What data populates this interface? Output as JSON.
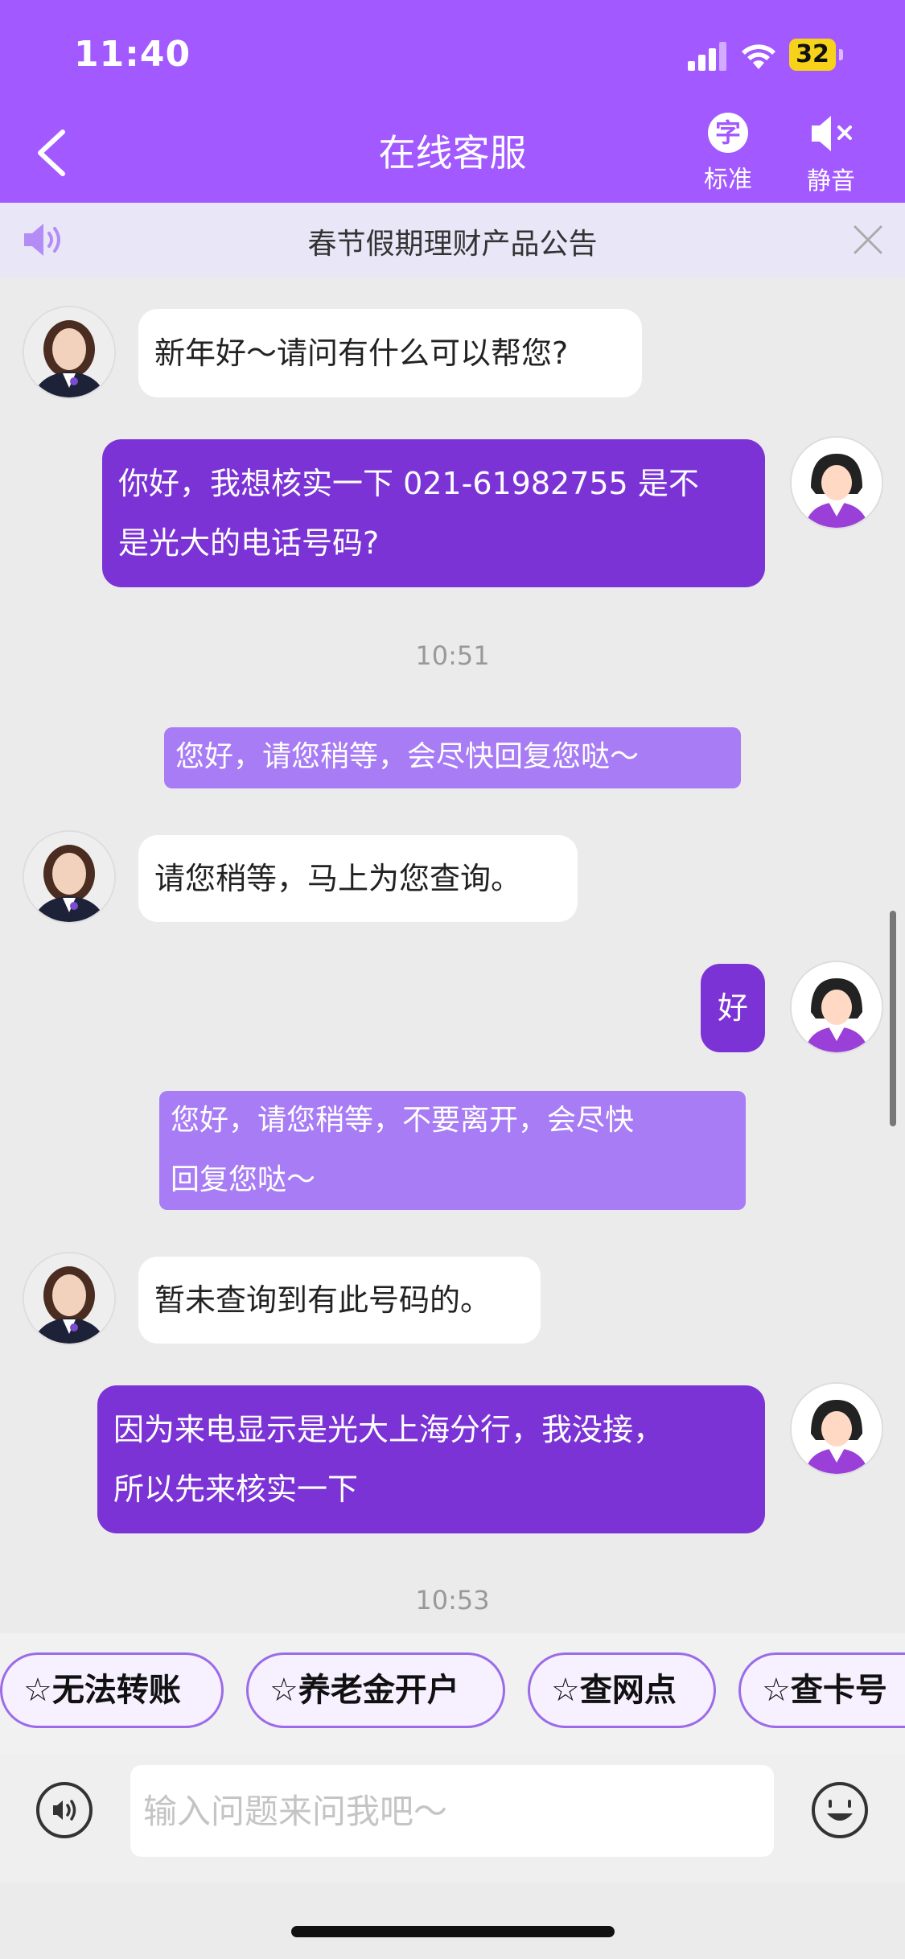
{
  "status_bar": {
    "time": "11:40",
    "battery": "32"
  },
  "nav": {
    "title": "在线客服",
    "standard_icon": "字",
    "standard_label": "标准",
    "mute_label": "静音"
  },
  "notice": {
    "text": "春节假期理财产品公告"
  },
  "messages": [
    {
      "type": "agent",
      "text": "新年好～请问有什么可以帮您?"
    },
    {
      "type": "user",
      "lines": [
        "你好，我想核实一下 021-61982755 是不",
        "是光大的电话号码?"
      ]
    },
    {
      "type": "time",
      "text": "10:51"
    },
    {
      "type": "system",
      "text": "您好，请您稍等，会尽快回复您哒～"
    },
    {
      "type": "agent",
      "text": "请您稍等，马上为您查询。"
    },
    {
      "type": "user",
      "text": "好"
    },
    {
      "type": "system",
      "lines": [
        "您好，请您稍等，不要离开，会尽快",
        "回复您哒～"
      ]
    },
    {
      "type": "agent",
      "text": "暂未查询到有此号码的。"
    },
    {
      "type": "user",
      "lines": [
        "因为来电显示是光大上海分行，我没接，",
        "所以先来核实一下"
      ]
    },
    {
      "type": "time",
      "text": "10:53"
    }
  ],
  "quick_replies": [
    "☆无法转账",
    "☆养老金开户",
    "☆查网点",
    "☆查卡号"
  ],
  "input": {
    "placeholder": "输入问题来问我吧～"
  },
  "colors": {
    "header": "#a259ff",
    "user_bubble": "#7b33d6",
    "system_bubble": "#a77cf5",
    "notice_bg": "#e9e6f8"
  },
  "icons": [
    "back-arrow-icon",
    "font-size-icon",
    "mute-speaker-icon",
    "speaker-icon",
    "close-icon",
    "voice-icon",
    "emoji-icon"
  ]
}
